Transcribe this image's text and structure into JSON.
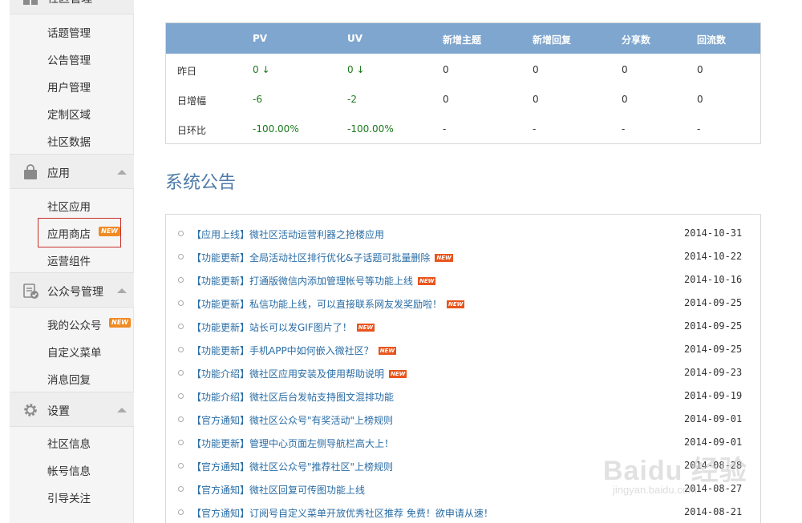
{
  "sidebar": {
    "groups": [
      {
        "title": "社区管理",
        "icon": "grid-icon",
        "items": [
          {
            "label": "话题管理"
          },
          {
            "label": "公告管理"
          },
          {
            "label": "用户管理"
          },
          {
            "label": "定制区域"
          },
          {
            "label": "社区数据"
          }
        ]
      },
      {
        "title": "应用",
        "icon": "bag-icon",
        "items": [
          {
            "label": "社区应用"
          },
          {
            "label": "应用商店",
            "badge": "NEW"
          },
          {
            "label": "运营组件"
          }
        ]
      },
      {
        "title": "公众号管理",
        "icon": "clipboard-check-icon",
        "items": [
          {
            "label": "我的公众号",
            "badge": "NEW"
          },
          {
            "label": "自定义菜单"
          },
          {
            "label": "消息回复"
          }
        ]
      },
      {
        "title": "设置",
        "icon": "gear-icon",
        "items": [
          {
            "label": "社区信息"
          },
          {
            "label": "帐号信息"
          },
          {
            "label": "引导关注"
          }
        ]
      }
    ]
  },
  "stats": {
    "headers": [
      "PV",
      "UV",
      "新增主题",
      "新增回复",
      "分享数",
      "回流数"
    ],
    "rows": [
      {
        "label": "昨日",
        "values": [
          "0 ↓",
          "0 ↓",
          "0",
          "0",
          "0",
          "0"
        ]
      },
      {
        "label": "日增幅",
        "values": [
          "-6",
          "-2",
          "0",
          "0",
          "0",
          "0"
        ]
      },
      {
        "label": "日环比",
        "values": [
          "-100.00%",
          "-100.00%",
          "-",
          "-",
          "-",
          "-"
        ]
      }
    ]
  },
  "notices": {
    "title": "系统公告",
    "new_tag": "NEW",
    "items": [
      {
        "text": "【应用上线】微社区活动运营利器之抢楼应用",
        "date": "2014-10-31",
        "new": false
      },
      {
        "text": "【功能更新】全局活动社区排行优化&子话题可批量删除",
        "date": "2014-10-22",
        "new": true
      },
      {
        "text": "【功能更新】打通版微信内添加管理帐号等功能上线",
        "date": "2014-10-16",
        "new": true
      },
      {
        "text": "【功能更新】私信功能上线，可以直接联系网友发奖励啦！",
        "date": "2014-09-25",
        "new": true
      },
      {
        "text": "【功能更新】站长可以发GIF图片了！",
        "date": "2014-09-25",
        "new": true
      },
      {
        "text": "【功能更新】手机APP中如何嵌入微社区？",
        "date": "2014-09-25",
        "new": true
      },
      {
        "text": "【功能介绍】微社区应用安装及使用帮助说明",
        "date": "2014-09-23",
        "new": true
      },
      {
        "text": "【功能介绍】微社区后台发帖支持图文混排功能",
        "date": "2014-09-19",
        "new": false
      },
      {
        "text": "【官方通知】微社区公众号\"有奖活动\"上榜规则",
        "date": "2014-09-01",
        "new": false
      },
      {
        "text": "【功能更新】管理中心页面左侧导航栏高大上！",
        "date": "2014-09-01",
        "new": false
      },
      {
        "text": "【官方通知】微社区公众号\"推荐社区\"上榜规则",
        "date": "2014-08-28",
        "new": false
      },
      {
        "text": "【官方通知】微社区回复可传图功能上线",
        "date": "2014-08-27",
        "new": false
      },
      {
        "text": "【官方通知】订阅号自定义菜单开放优秀社区推荐 免费！欲申请从速！",
        "date": "2014-08-21",
        "new": false
      }
    ]
  },
  "watermark": {
    "brand": "Baidu 经验",
    "url": "jingyan.baidu.com"
  },
  "colors": {
    "table_header": "#7ea6cf",
    "link": "#2a6da5",
    "positive": "#1b7a1b",
    "highlight_box": "#c9302c",
    "new_badge": "#f08a24"
  }
}
